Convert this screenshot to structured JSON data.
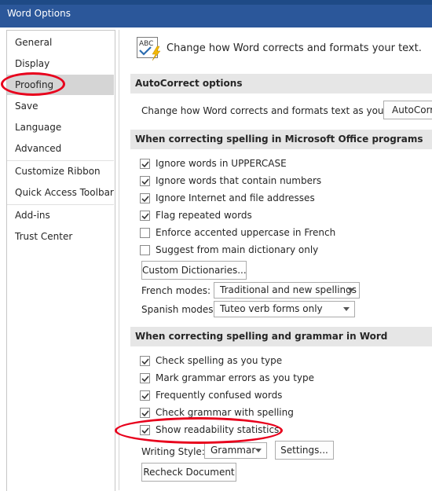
{
  "window": {
    "title": "Word Options"
  },
  "sidebar": {
    "items": [
      {
        "label": "General"
      },
      {
        "label": "Display"
      },
      {
        "label": "Proofing",
        "selected": true
      },
      {
        "label": "Save"
      },
      {
        "label": "Language"
      },
      {
        "label": "Advanced"
      },
      {
        "label": "Customize Ribbon"
      },
      {
        "label": "Quick Access Toolbar"
      },
      {
        "label": "Add-ins"
      },
      {
        "label": "Trust Center"
      }
    ]
  },
  "main": {
    "header_text": "Change how Word corrects and formats your text.",
    "autocorrect": {
      "section_title": "AutoCorrect options",
      "description": "Change how Word corrects and formats text as you type:",
      "button_label": "AutoCorrect Options..."
    },
    "office_spelling": {
      "section_title": "When correcting spelling in Microsoft Office programs",
      "options": [
        {
          "label": "Ignore words in UPPERCASE",
          "checked": true
        },
        {
          "label": "Ignore words that contain numbers",
          "checked": true
        },
        {
          "label": "Ignore Internet and file addresses",
          "checked": true
        },
        {
          "label": "Flag repeated words",
          "checked": true
        },
        {
          "label": "Enforce accented uppercase in French",
          "checked": false
        },
        {
          "label": "Suggest from main dictionary only",
          "checked": false
        }
      ],
      "custom_dictionaries_label": "Custom Dictionaries...",
      "french_modes_label": "French modes:",
      "french_modes_value": "Traditional and new spellings",
      "spanish_modes_label": "Spanish modes:",
      "spanish_modes_value": "Tuteo verb forms only"
    },
    "word_spelling": {
      "section_title": "When correcting spelling and grammar in Word",
      "options": [
        {
          "label": "Check spelling as you type",
          "checked": true
        },
        {
          "label": "Mark grammar errors as you type",
          "checked": true
        },
        {
          "label": "Frequently confused words",
          "checked": true
        },
        {
          "label": "Check grammar with spelling",
          "checked": true
        },
        {
          "label": "Show readability statistics",
          "checked": true
        }
      ],
      "writing_style_label": "Writing Style:",
      "writing_style_value": "Grammar",
      "settings_label": "Settings...",
      "recheck_label": "Recheck Document"
    }
  },
  "colors": {
    "titlebar": "#2b579a",
    "annotation": "#e8001c",
    "selected_nav": "#d5d5d5",
    "section_header": "#e6e6e6"
  },
  "icons": [
    "abc-check-icon",
    "checkbox-check-icon",
    "dropdown-caret-icon"
  ]
}
